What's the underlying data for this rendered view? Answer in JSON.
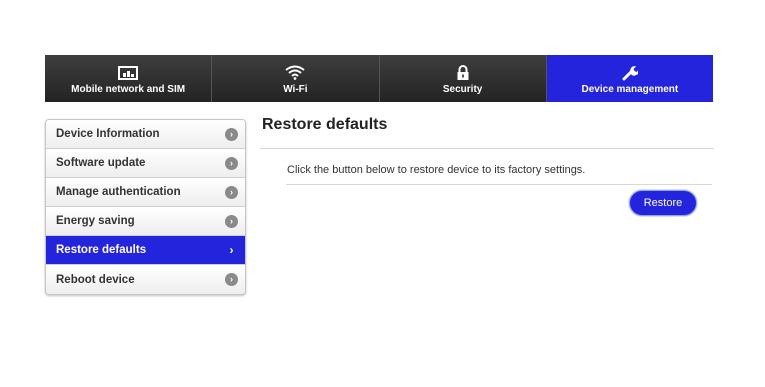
{
  "nav": {
    "tabs": [
      {
        "label": "Mobile network and SIM",
        "icon": "sim-card-icon",
        "active": false
      },
      {
        "label": "Wi-Fi",
        "icon": "wifi-icon",
        "active": false
      },
      {
        "label": "Security",
        "icon": "lock-icon",
        "active": false
      },
      {
        "label": "Device management",
        "icon": "wrench-icon",
        "active": true
      }
    ]
  },
  "sidebar": {
    "items": [
      {
        "label": "Device Information",
        "active": false
      },
      {
        "label": "Software update",
        "active": false
      },
      {
        "label": "Manage authentication",
        "active": false
      },
      {
        "label": "Energy saving",
        "active": false
      },
      {
        "label": "Restore defaults",
        "active": true
      },
      {
        "label": "Reboot device",
        "active": false
      }
    ]
  },
  "main": {
    "title": "Restore defaults",
    "description": "Click the button below to restore device to its factory settings.",
    "restore_label": "Restore"
  },
  "colors": {
    "accent": "#2424dd",
    "nav_background": "#2b2b2b"
  }
}
